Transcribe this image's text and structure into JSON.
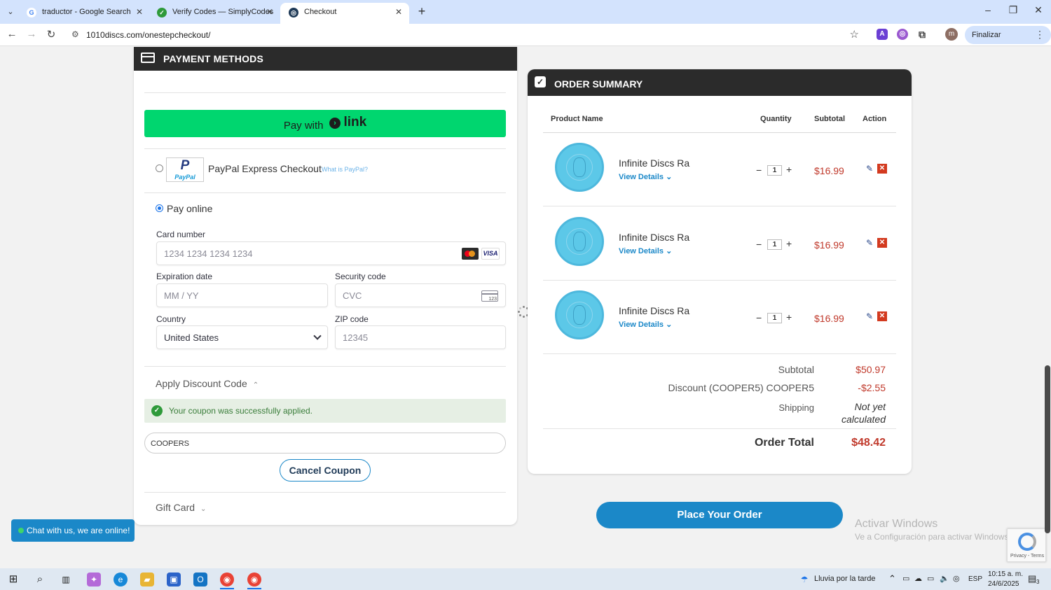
{
  "browser": {
    "tabs": [
      {
        "title": "traductor - Google Search",
        "favicon": "G",
        "favicon_color": "#ffffff",
        "favicon_text_color": "#4285f4",
        "active": false
      },
      {
        "title": "Verify Codes — SimplyCodes",
        "favicon": "✓",
        "favicon_color": "#2e9a3a",
        "favicon_text_color": "#ffffff",
        "active": false
      },
      {
        "title": "Checkout",
        "favicon": "◎",
        "favicon_color": "#1f3a57",
        "favicon_text_color": "#ffffff",
        "active": true
      }
    ],
    "new_tab": "+",
    "url": "1010discs.com/onestepcheckout/",
    "update_button": "Finalizar actualización",
    "profile_initial": "m",
    "window_controls": {
      "minimize": "–",
      "maximize": "❐",
      "close": "✕"
    }
  },
  "payment": {
    "title": "PAYMENT METHODS",
    "link_button": {
      "pay_with": "Pay with",
      "brand": "link"
    },
    "paypal": {
      "label": "PayPal Express Checkout",
      "what_is": "What is PayPal?",
      "logo_top": "P",
      "logo_bottom": "PayPal"
    },
    "pay_online": "Pay online",
    "card_number": {
      "label": "Card number",
      "placeholder": "1234 1234 1234 1234",
      "brand_visa": "VISA"
    },
    "expiration": {
      "label": "Expiration date",
      "placeholder": "MM / YY"
    },
    "security": {
      "label": "Security code",
      "placeholder": "CVC",
      "icon_text": "123"
    },
    "country": {
      "label": "Country",
      "value": "United States"
    },
    "zip": {
      "label": "ZIP code",
      "placeholder": "12345"
    },
    "discount": {
      "toggle_label": "Apply Discount Code",
      "success_message": "Your coupon was successfully applied.",
      "code_value": "COOPERS",
      "cancel_label": "Cancel Coupon"
    },
    "gift_card": "Gift Card"
  },
  "summary": {
    "title": "ORDER SUMMARY",
    "columns": {
      "product": "Product Name",
      "quantity": "Quantity",
      "subtotal": "Subtotal",
      "action": "Action"
    },
    "items": [
      {
        "name": "Infinite Discs Ra",
        "details": "View Details",
        "qty": "1",
        "price": "$16.99"
      },
      {
        "name": "Infinite Discs Ra",
        "details": "View Details",
        "qty": "1",
        "price": "$16.99"
      },
      {
        "name": "Infinite Discs Ra",
        "details": "View Details",
        "qty": "1",
        "price": "$16.99"
      }
    ],
    "totals": {
      "subtotal_label": "Subtotal",
      "subtotal_value": "$50.97",
      "discount_label": "Discount (COOPER5) COOPER5",
      "discount_value": "-$2.55",
      "shipping_label": "Shipping",
      "shipping_value_line1": "Not yet",
      "shipping_value_line2": "calculated",
      "order_total_label": "Order Total",
      "order_total_value": "$48.42"
    },
    "place_order": "Place Your Order"
  },
  "chat": "Chat with us, we are online!",
  "windows_watermark": {
    "line1": "Activar Windows",
    "line2": "Ve a Configuración para activar Windows."
  },
  "recaptcha": "Privacy - Terms",
  "taskbar": {
    "weather": "Lluvia por la tarde",
    "language": "ESP",
    "time": "10:15 a. m.",
    "date": "24/6/2025",
    "notification_count": "3"
  },
  "colors": {
    "accent": "#1b88c8",
    "link_green": "#00d66f",
    "price_red": "#c0392b",
    "header_dark": "#2b2b2b"
  }
}
